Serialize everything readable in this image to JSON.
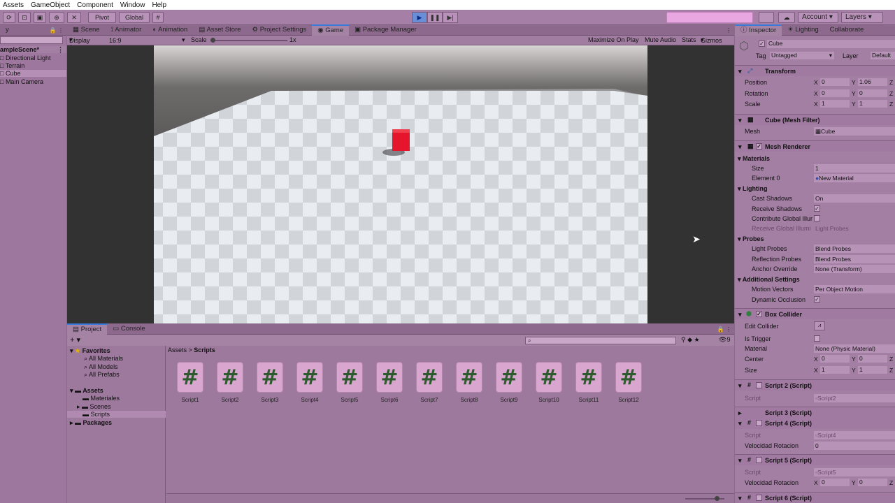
{
  "menu": [
    "Assets",
    "GameObject",
    "Component",
    "Window",
    "Help"
  ],
  "toolbar": {
    "pivot": "Pivot",
    "global": "Global",
    "account": "Account",
    "layers": "Layers",
    "accent": "#e8a7e0"
  },
  "hierarchy": {
    "scene": "ampleScene*",
    "items": [
      "Directional Light",
      "Terrain",
      "Cube",
      "Main Camera"
    ]
  },
  "center_tabs": [
    "Scene",
    "Animator",
    "Animation",
    "Asset Store",
    "Project Settings",
    "Game",
    "Package Manager"
  ],
  "active_center_tab": "Game",
  "gamebar": {
    "display": "Display 1",
    "aspect": "16:9",
    "scale_label": "Scale",
    "scale_value": "1x",
    "maximize": "Maximize On Play",
    "mute": "Mute Audio",
    "stats": "Stats",
    "gizmos": "Gizmos"
  },
  "project": {
    "tabs": [
      "Project",
      "Console"
    ],
    "search_placeholder": "",
    "count": "9",
    "favorites": {
      "title": "Favorites",
      "items": [
        "All Materials",
        "All Models",
        "All Prefabs"
      ]
    },
    "assets": {
      "title": "Assets",
      "items": [
        "Materiales",
        "Scenes",
        "Scripts"
      ]
    },
    "packages": "Packages",
    "breadcrumb": [
      "Assets",
      "Scripts"
    ],
    "scripts": [
      "Script1",
      "Script2",
      "Script3",
      "Script4",
      "Script5",
      "Script6",
      "Script7",
      "Script8",
      "Script9",
      "Script10",
      "Script11",
      "Script12"
    ]
  },
  "inspector": {
    "tabs": [
      "Inspector",
      "Lighting",
      "Collaborate"
    ],
    "object_name": "Cube",
    "tag_label": "Tag",
    "tag_value": "Untagged",
    "layer_label": "Layer",
    "layer_value": "Default",
    "transform": {
      "title": "Transform",
      "position": {
        "label": "Position",
        "x": "0",
        "y": "1.06"
      },
      "rotation": {
        "label": "Rotation",
        "x": "0",
        "y": "0"
      },
      "scale": {
        "label": "Scale",
        "x": "1",
        "y": "1"
      }
    },
    "mesh_filter": {
      "title": "Cube (Mesh Filter)",
      "mesh_label": "Mesh",
      "mesh_value": "Cube"
    },
    "mesh_renderer": {
      "title": "Mesh Renderer",
      "materials": "Materials",
      "size_label": "Size",
      "size_value": "1",
      "element_label": "Element 0",
      "element_value": "New Material",
      "lighting": "Lighting",
      "cast_label": "Cast Shadows",
      "cast_value": "On",
      "receive_label": "Receive Shadows",
      "contribute_label": "Contribute Global Illur",
      "receive_gi_label": "Receive Global Illumi",
      "receive_gi_value": "Light Probes",
      "probes": "Probes",
      "light_probes_label": "Light Probes",
      "light_probes_value": "Blend Probes",
      "refl_label": "Reflection Probes",
      "refl_value": "Blend Probes",
      "anchor_label": "Anchor Override",
      "anchor_value": "None (Transform)",
      "additional": "Additional Settings",
      "motion_label": "Motion Vectors",
      "motion_value": "Per Object Motion",
      "occlusion_label": "Dynamic Occlusion"
    },
    "box_collider": {
      "title": "Box Collider",
      "edit_label": "Edit Collider",
      "trigger_label": "Is Trigger",
      "material_label": "Material",
      "material_value": "None (Physic Material)",
      "center_label": "Center",
      "center_x": "0",
      "center_y": "0",
      "size_label": "Size",
      "size_x": "1",
      "size_y": "1"
    },
    "scripts": [
      {
        "title": "Script 2 (Script)",
        "script_label": "Script",
        "script_value": "Script2"
      },
      {
        "title": "Script 3 (Script)"
      },
      {
        "title": "Script 4 (Script)",
        "script_label": "Script",
        "script_value": "Script4",
        "field_label": "Velocidad Rotacion",
        "field_value": "0"
      },
      {
        "title": "Script 5 (Script)",
        "script_label": "Script",
        "script_value": "Script5",
        "field_label": "Velocidad Rotacion",
        "x": "0",
        "y": "0"
      },
      {
        "title": "Script 6 (Script)"
      }
    ]
  }
}
